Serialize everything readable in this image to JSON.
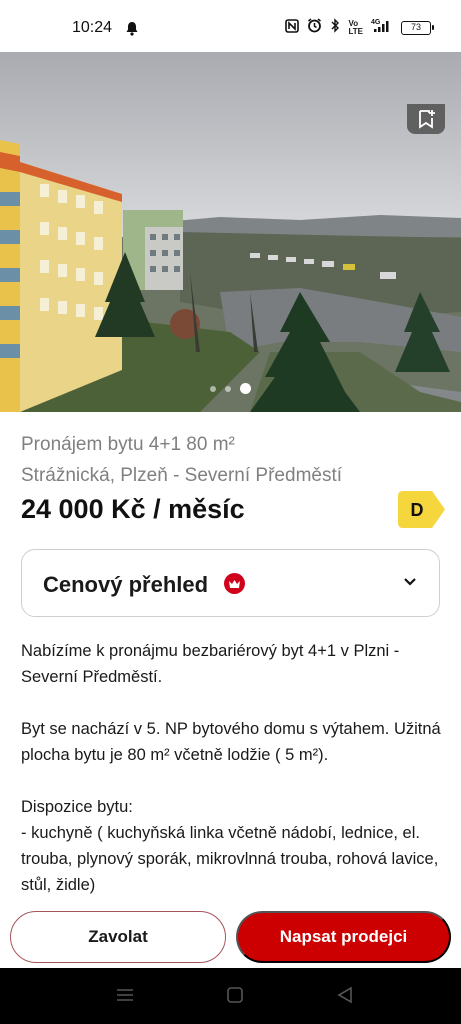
{
  "status_bar": {
    "time": "10:24",
    "battery": "73",
    "network": "4G",
    "icons": [
      "bell-icon",
      "nfc-icon",
      "alarm-icon",
      "bluetooth-icon",
      "volte-icon",
      "signal-icon",
      "battery-icon"
    ]
  },
  "gallery": {
    "image_count": 3,
    "active_index": 2
  },
  "listing": {
    "title": "Pronájem bytu 4+1 80 m²",
    "location": "Strážnická, Plzeň - Severní Předměstí",
    "price": "24 000 Kč / měsíc",
    "energy_class": "D"
  },
  "price_overview": {
    "label": "Cenový přehled"
  },
  "description": "Nabízíme k pronájmu bezbariérový byt 4+1 v Plzni - Severní Předměstí.\n\nByt se nachází v 5. NP bytového domu s výtahem. Užitná plocha bytu je 80 m² včetně lodžie ( 5 m²).\n\nDispozice bytu:\n- kuchyně ( kuchyňská linka včetně nádobí, lednice, el. trouba, plynový sporák, mikrovlnná trouba, rohová lavice, stůl, židle)",
  "actions": {
    "call_label": "Zavolat",
    "message_label": "Napsat prodejci"
  },
  "colors": {
    "accent": "#cc0000",
    "energy_badge": "#f5d63d",
    "muted_text": "#808080"
  }
}
